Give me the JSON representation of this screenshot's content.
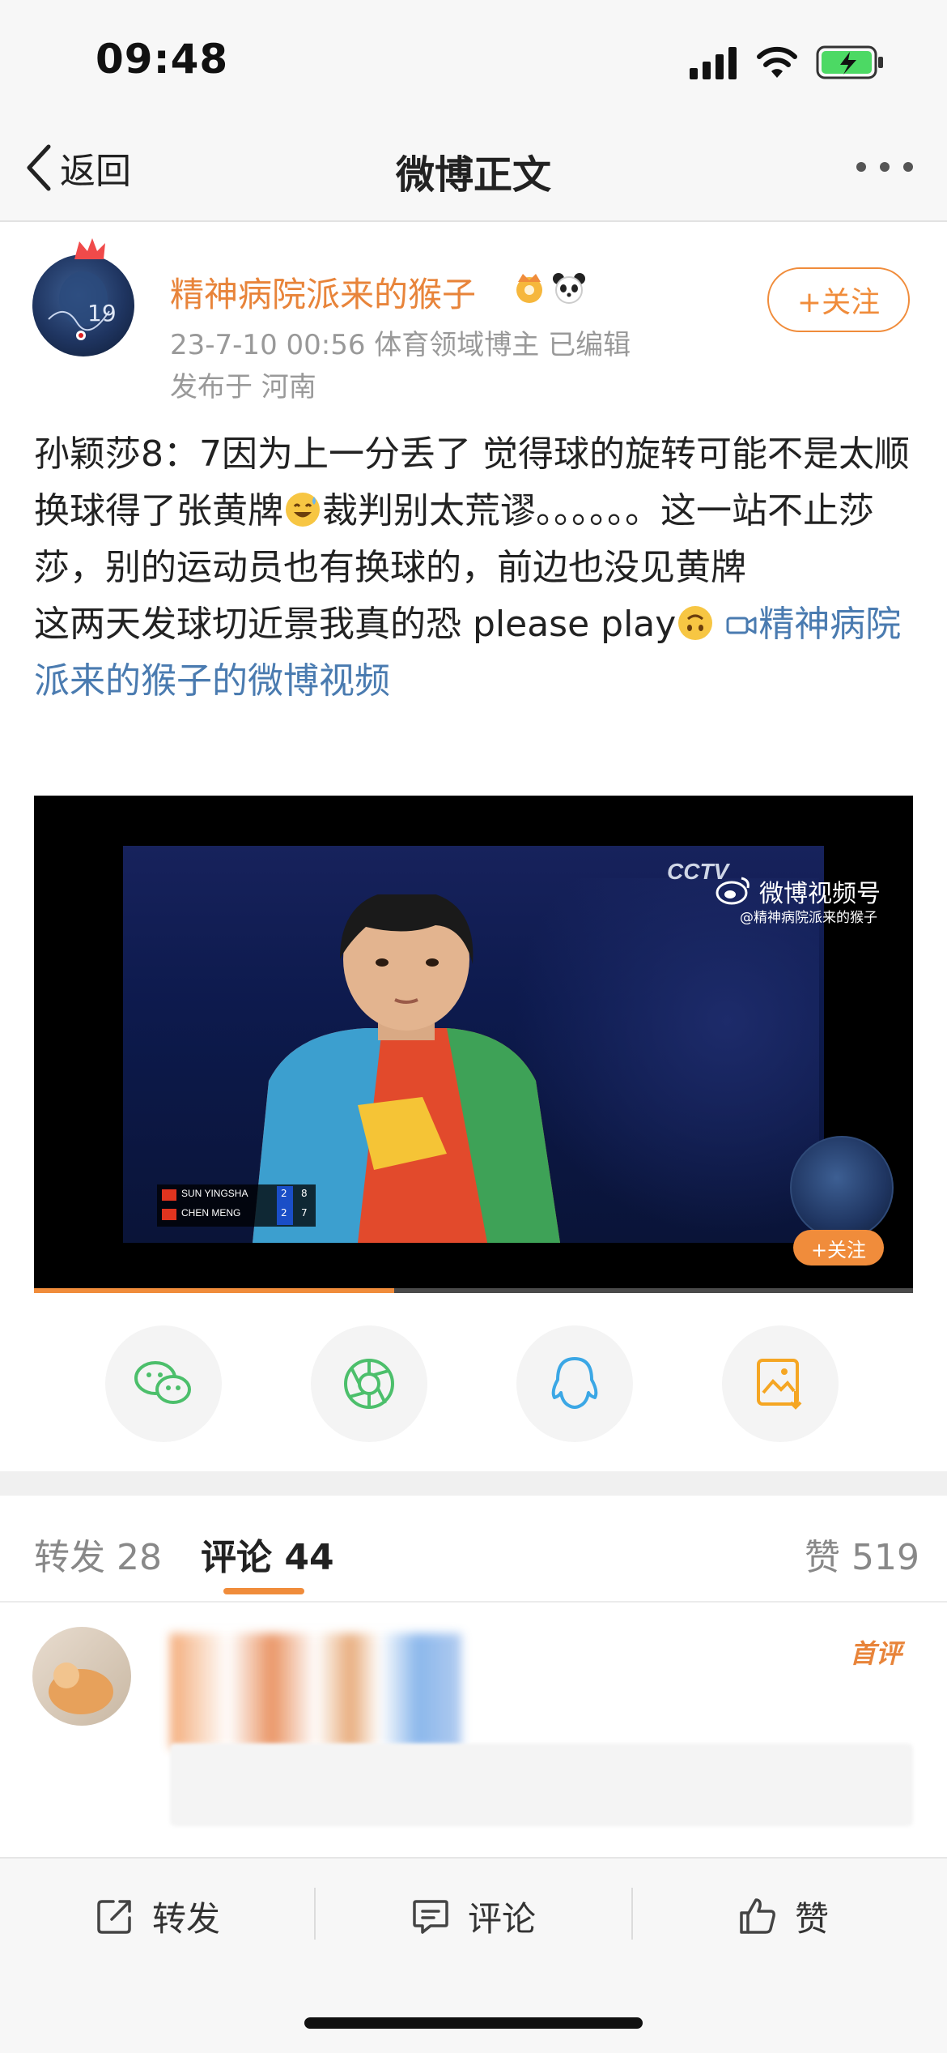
{
  "status_bar": {
    "time": "09:48",
    "signal_icon": "cellular-signal-icon",
    "wifi_icon": "wifi-icon",
    "battery_icon": "battery-charging-icon"
  },
  "nav": {
    "back_label": "返回",
    "title": "微博正文",
    "more_icon": "more-dots-icon"
  },
  "post": {
    "username": "精神病院派来的猴子",
    "meta_line1": "23-7-10 00:56  体育领域博主  已编辑",
    "meta_line2": "发布于 河南",
    "follow_label": "+关注",
    "text_part1": "孙颖莎8：7因为上一分丢了 觉得球的旋转可能不是太顺 换球得了张黄牌",
    "text_part2": "裁判别太荒谬。。。。。。这一站不止莎莎，别的运动员也有换球的，前边也没见黄牌",
    "text_part3": "这两天发球切近景我真的恐 please play",
    "video_link": "精神病院派来的猴子的微博视频"
  },
  "video": {
    "channel_logo": "CCTV",
    "watermark_title": "微博视频号",
    "watermark_user": "@精神病院派来的猴子",
    "score_player1": "SUN YINGSHA",
    "score_player2": "CHEN MENG",
    "score_p1_games": "2",
    "score_p1_points": "8",
    "score_p2_games": "2",
    "score_p2_points": "7",
    "follow_label": "+关注",
    "progress_fraction": 0.41
  },
  "share": [
    "wechat-icon",
    "moments-icon",
    "qq-icon",
    "save-image-icon"
  ],
  "tabs": {
    "repost_label": "转发",
    "repost_count": "28",
    "comment_label": "评论",
    "comment_count": "44",
    "like_label": "赞",
    "like_count": "519"
  },
  "comment": {
    "badge": "首评"
  },
  "toolbar": {
    "repost": "转发",
    "comment": "评论",
    "like": "赞"
  },
  "colors": {
    "accent": "#f08c3b",
    "link": "#4a7bb0",
    "username": "#e8843a"
  }
}
